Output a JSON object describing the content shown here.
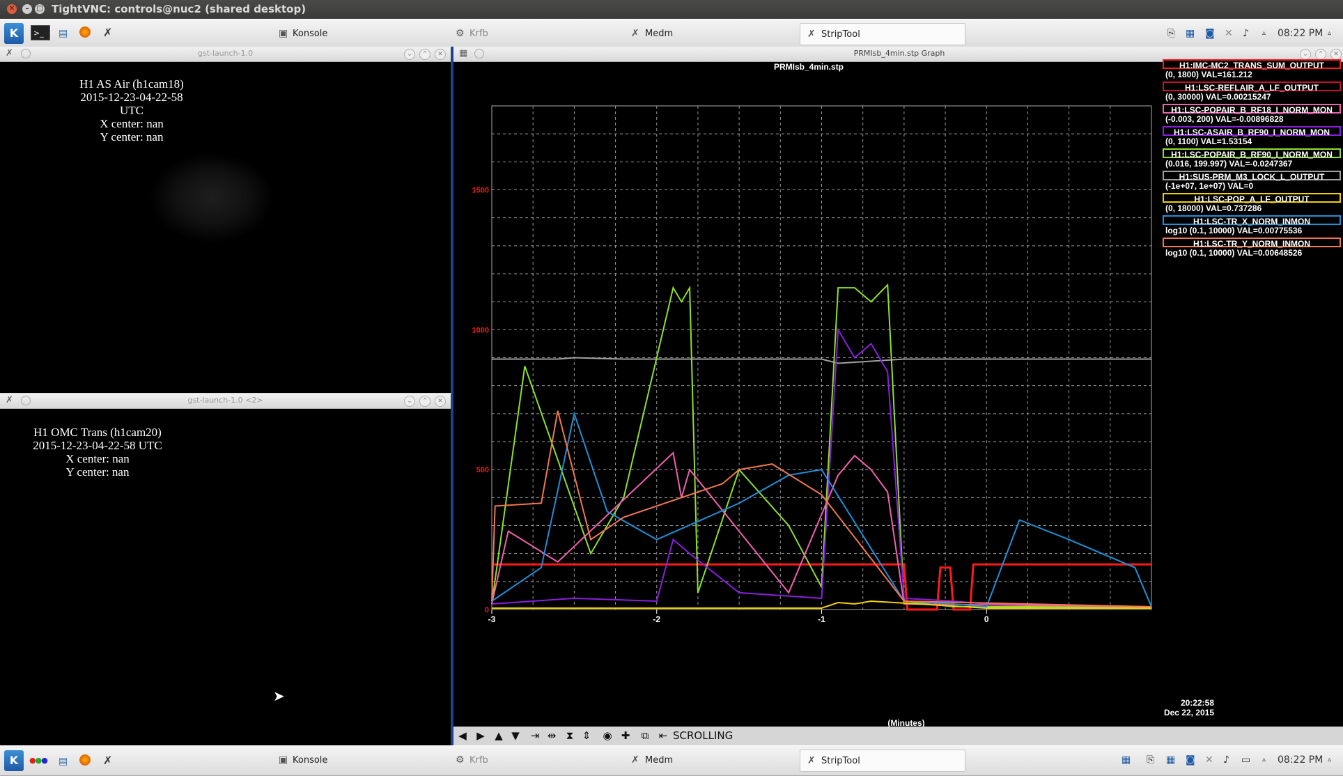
{
  "vnc": {
    "title": "TightVNC: controls@nuc2 (shared desktop)"
  },
  "taskbar_top": {
    "tasks": [
      {
        "label": "Konsole",
        "icon": "konsole-icon"
      },
      {
        "label": "Krfb",
        "icon": "krfb-icon"
      },
      {
        "label": "Medm",
        "icon": "medm-icon"
      },
      {
        "label": "StripTool",
        "icon": "striptool-icon"
      }
    ],
    "clock": "08:22 PM"
  },
  "taskbar_bottom": {
    "tasks": [
      {
        "label": "Konsole"
      },
      {
        "label": "Krfb"
      },
      {
        "label": "Medm"
      },
      {
        "label": "StripTool"
      }
    ],
    "clock": "08:22 PM"
  },
  "cam1": {
    "window_title": "gst-launch-1.0",
    "line1": "H1 AS Air (h1cam18)",
    "line2": "2015-12-23-04-22-58 UTC",
    "line3": "X center: nan",
    "line4": "Y center: nan"
  },
  "cam2": {
    "window_title": "gst-launch-1.0 <2>",
    "line1": "H1 OMC Trans (h1cam20)",
    "line2": "2015-12-23-04-22-58 UTC",
    "line3": "X center: nan",
    "line4": "Y center: nan"
  },
  "striptool": {
    "window_title": "PRMIsb_4min.stp Graph",
    "plot_title": "PRMIsb_4min.stp",
    "time_label": "20:22:58",
    "date_label": "Dec 22, 2015",
    "x_axis_label": "(Minutes)",
    "mode_label": "SCROLLING",
    "legend": [
      {
        "name": "H1:IMC-MC2_TRANS_SUM_OUTPUT",
        "range": "(0, 1800) VAL=161.212",
        "color": "#ff1a1a"
      },
      {
        "name": "H1:LSC-REFLAIR_A_LF_OUTPUT",
        "range": "(0, 30000) VAL=0.00215247",
        "color": "#c8102e"
      },
      {
        "name": "H1:LSC-POPAIR_B_RF18_I_NORM_MON",
        "range": "(-0.003, 200) VAL=-0.00896828",
        "color": "#f060b0"
      },
      {
        "name": "H1:LSC-ASAIR_B_RF90_I_NORM_MON",
        "range": "(0, 1100) VAL=1.53154",
        "color": "#8a1ee0"
      },
      {
        "name": "H1:LSC-POPAIR_B_RF90_I_NORM_MON",
        "range": "(0.016, 199.997) VAL=-0.0247367",
        "color": "#8ee02a"
      },
      {
        "name": "H1:SUS-PRM_M3_LOCK_L_OUTPUT",
        "range": "(-1e+07, 1e+07) VAL=0",
        "color": "#a0a0a0"
      },
      {
        "name": "H1:LSC-POP_A_LF_OUTPUT",
        "range": "(0, 18000) VAL=0.737286",
        "color": "#f0d000"
      },
      {
        "name": "H1:LSC-TR_X_NORM_INMON",
        "range": "log10 (0.1, 10000) VAL=0.00775536",
        "color": "#1e90d8"
      },
      {
        "name": "H1:LSC-TR_Y_NORM_INMON",
        "range": "log10 (0.1, 10000) VAL=0.00648526",
        "color": "#f07850"
      }
    ]
  },
  "chart_data": {
    "type": "line",
    "title": "PRMIsb_4min.stp",
    "xlabel": "(Minutes)",
    "ylabel": "",
    "xlim": [
      -3,
      1
    ],
    "ylim": [
      0,
      1800
    ],
    "x_ticks": [
      "-3",
      "-2",
      "-1",
      "0"
    ],
    "y_ticks": [
      "0",
      "500",
      "1000",
      "1500"
    ],
    "grid": true,
    "legend_position": "right",
    "series": [
      {
        "name": "H1:IMC-MC2_TRANS_SUM_OUTPUT",
        "color": "#ff1a1a",
        "x": [
          -3.0,
          -2.9,
          -0.5,
          -0.48,
          -0.3,
          -0.28,
          -0.22,
          -0.2,
          -0.1,
          -0.08,
          1.0
        ],
        "y": [
          161,
          161,
          161,
          0,
          0,
          150,
          150,
          0,
          0,
          161,
          161
        ]
      },
      {
        "name": "H1:SUS-PRM_M3_LOCK_L_OUTPUT",
        "color": "#a0a0a0",
        "x": [
          -3.0,
          -2.6,
          -2.5,
          -2.2,
          -1.0,
          -0.9,
          -0.5,
          1.0
        ],
        "y": [
          895,
          895,
          900,
          895,
          895,
          880,
          895,
          895
        ]
      },
      {
        "name": "H1:LSC-POPAIR_B_RF90_I_NORM_MON",
        "color": "#8ee02a",
        "x": [
          -3.0,
          -2.8,
          -2.4,
          -2.2,
          -1.9,
          -1.85,
          -1.8,
          -1.75,
          -1.5,
          -1.2,
          -1.0,
          -0.9,
          -0.8,
          -0.7,
          -0.6,
          -0.5,
          -0.2,
          1.0
        ],
        "y": [
          20,
          870,
          200,
          400,
          1150,
          1100,
          1150,
          60,
          500,
          300,
          80,
          1150,
          1150,
          1100,
          1160,
          30,
          10,
          10
        ]
      },
      {
        "name": "H1:LSC-ASAIR_B_RF90_I_NORM_MON",
        "color": "#8a1ee0",
        "x": [
          -3.0,
          -2.5,
          -2.0,
          -1.9,
          -1.8,
          -1.5,
          -1.0,
          -0.9,
          -0.8,
          -0.7,
          -0.6,
          -0.5,
          -0.2,
          0.0,
          1.0
        ],
        "y": [
          20,
          40,
          30,
          250,
          200,
          60,
          40,
          1000,
          900,
          950,
          850,
          40,
          30,
          20,
          10
        ]
      },
      {
        "name": "H1:LSC-POPAIR_B_RF18_I_NORM_MON",
        "color": "#f060b0",
        "x": [
          -3.0,
          -2.9,
          -2.6,
          -1.9,
          -1.85,
          -1.8,
          -1.2,
          -0.9,
          -0.8,
          -0.7,
          -0.6,
          -0.5,
          1.0
        ],
        "y": [
          20,
          280,
          170,
          560,
          400,
          500,
          60,
          480,
          550,
          500,
          420,
          20,
          10
        ]
      },
      {
        "name": "H1:LSC-TR_X_NORM_INMON",
        "color": "#1e90d8",
        "x": [
          -3.0,
          -2.7,
          -2.5,
          -2.3,
          -2.0,
          -1.5,
          -1.2,
          -1.0,
          -0.5,
          -0.2,
          0.0,
          0.2,
          0.5,
          0.9,
          1.0
        ],
        "y": [
          30,
          150,
          700,
          350,
          250,
          380,
          480,
          500,
          30,
          20,
          10,
          320,
          250,
          150,
          10
        ]
      },
      {
        "name": "H1:LSC-TR_Y_NORM_INMON",
        "color": "#f07850",
        "x": [
          -3.0,
          -2.98,
          -2.7,
          -2.6,
          -2.4,
          -2.2,
          -1.6,
          -1.5,
          -1.3,
          -1.0,
          -0.5,
          1.0
        ],
        "y": [
          30,
          370,
          380,
          710,
          250,
          330,
          450,
          500,
          520,
          410,
          30,
          10
        ]
      },
      {
        "name": "H1:LSC-POP_A_LF_OUTPUT",
        "color": "#f0d000",
        "x": [
          -3.0,
          -2.0,
          -1.0,
          -0.9,
          -0.8,
          -0.7,
          0.0,
          1.0
        ],
        "y": [
          5,
          5,
          5,
          25,
          20,
          30,
          5,
          5
        ]
      }
    ]
  }
}
